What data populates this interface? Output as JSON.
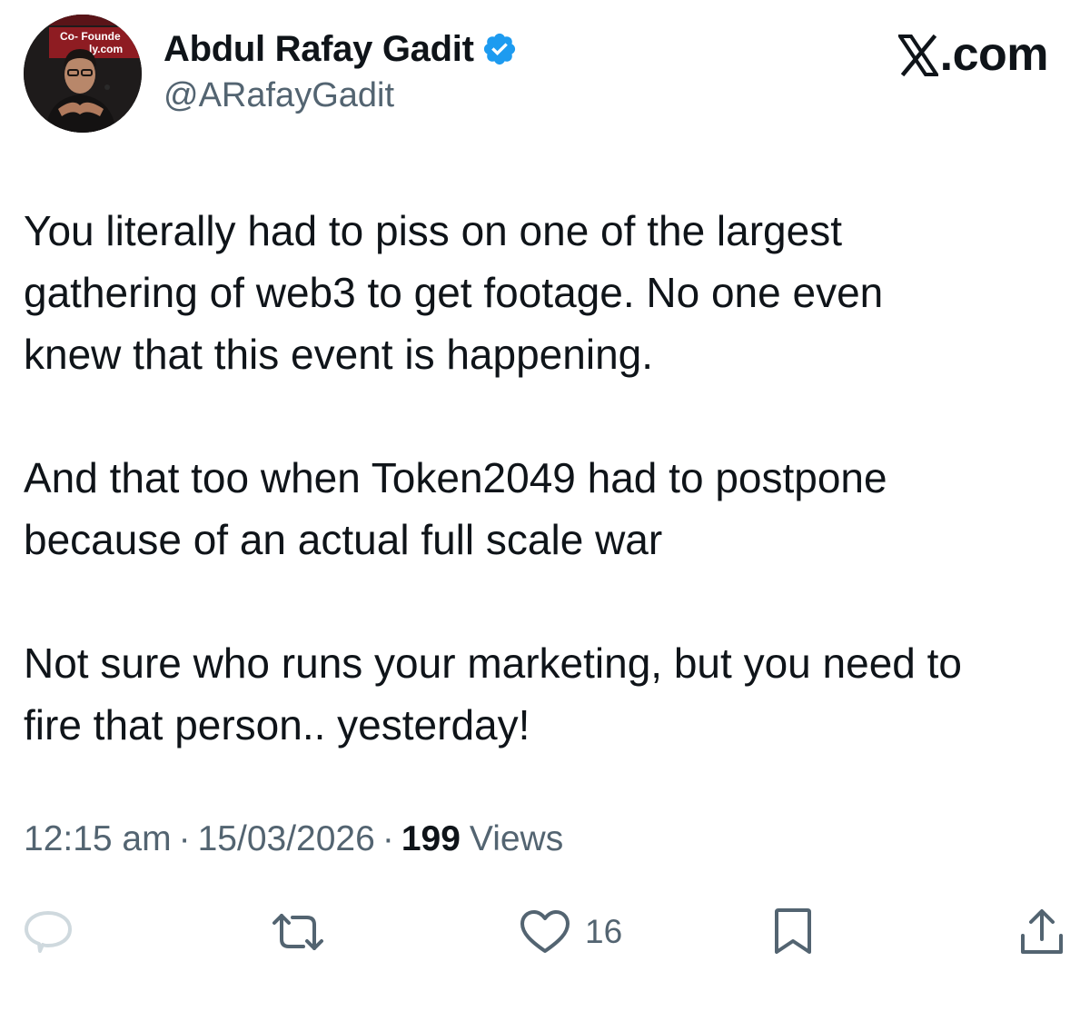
{
  "author": {
    "display_name": "Abdul Rafay Gadit",
    "handle": "@ARafayGadit",
    "verified": true,
    "avatar_banner_lines": [
      "Co- Founde",
      "ly.com"
    ]
  },
  "brand": {
    "label": ".com",
    "icon": "x-logo-icon"
  },
  "tweet": {
    "paragraphs": [
      "You literally had to piss on one of the largest\ngathering of web3 to get footage. No one even\nknew that this event is happening.",
      "And that too when Token2049 had to postpone\nbecause of an actual full scale war",
      "Not sure who runs your marketing, but you need to\nfire that person.. yesterday!"
    ],
    "time": "12:15 am",
    "date": "15/03/2026",
    "separator": "·",
    "views_count": "199",
    "views_label": "Views"
  },
  "actions": {
    "reply": {
      "icon": "reply-icon"
    },
    "repost": {
      "icon": "repost-icon"
    },
    "like": {
      "icon": "heart-icon",
      "count": "16"
    },
    "bookmark": {
      "icon": "bookmark-icon"
    },
    "share": {
      "icon": "share-icon"
    }
  },
  "colors": {
    "text": "#0f1419",
    "secondary": "#536471",
    "verified": "#1d9bf0",
    "reply_icon": "#cfd9de",
    "action_icon": "#536471"
  }
}
